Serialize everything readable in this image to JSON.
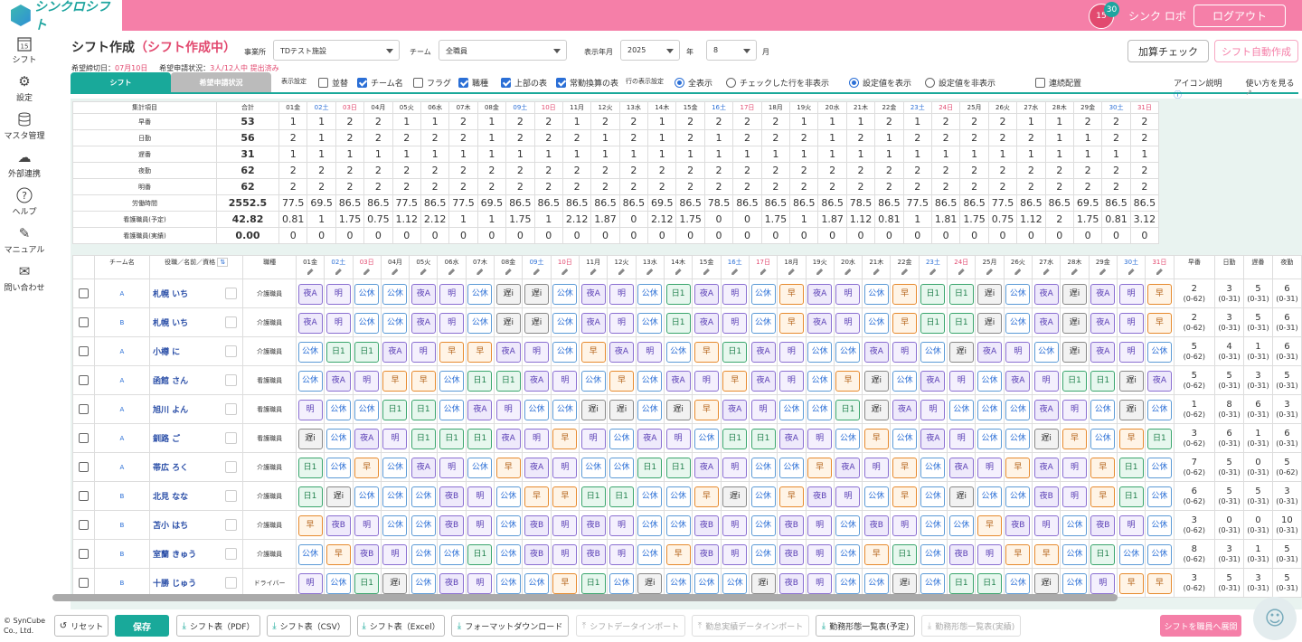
{
  "app": {
    "logo": "シンクロシフト",
    "cal_icon": "15",
    "cal_badge": "30",
    "user": "シンク ロボ",
    "logout": "ログアウト"
  },
  "nav": [
    {
      "label": "シフト",
      "icon": "calendar-icon"
    },
    {
      "label": "設定",
      "icon": "gear-icon"
    },
    {
      "label": "マスタ管理",
      "icon": "database-icon"
    },
    {
      "label": "外部連携",
      "icon": "cloud-icon"
    },
    {
      "label": "ヘルプ",
      "icon": "question-icon"
    },
    {
      "label": "マニュアル",
      "icon": "pencil-icon"
    },
    {
      "label": "問い合わせ",
      "icon": "mail-icon"
    }
  ],
  "page": {
    "title": "シフト作成",
    "mode": "（シフト作成中）",
    "deadline_label": "希望締切日：",
    "deadline": "07月10日",
    "status_label": "希望申請状況：",
    "status": "3人/12人中 提出済み"
  },
  "filters": {
    "facility_label": "事業所",
    "facility": "TDテスト施設",
    "team_label": "チーム",
    "team": "全職員",
    "ym_label": "表示年月",
    "year": "2025",
    "year_unit": "年",
    "month": "8",
    "month_unit": "月"
  },
  "buttons": {
    "calc": "加算チェック",
    "auto": "シフト自動作成"
  },
  "tabs": {
    "shift": "シフト",
    "request": "希望申請状況"
  },
  "options": {
    "display_label": "表示設定",
    "sort": "並替",
    "team_name": "チーム名",
    "flag": "フラグ",
    "job": "職種",
    "upper": "上部の表",
    "fte": "常勤換算の表",
    "row_label": "行の表示設定",
    "show_all": "全表示",
    "hide_checked": "チェックした行を非表示",
    "show_set": "設定値を表示",
    "hide_set": "設定値を非表示",
    "continuous": "連続配置",
    "icon_help": "アイコン説明",
    "howto": "使い方を見る"
  },
  "days": [
    "01金",
    "02土",
    "03日",
    "04月",
    "05火",
    "06水",
    "07木",
    "08金",
    "09土",
    "10日",
    "11月",
    "12火",
    "13水",
    "14木",
    "15金",
    "16土",
    "17日",
    "18月",
    "19火",
    "20水",
    "21木",
    "22金",
    "23土",
    "24日",
    "25月",
    "26火",
    "27水",
    "28木",
    "29金",
    "30土",
    "31日"
  ],
  "summary": {
    "header_item": "集計項目",
    "header_total": "合計",
    "rows": [
      {
        "label": "早番",
        "total": "53",
        "vals": [
          "1",
          "1",
          "2",
          "2",
          "1",
          "1",
          "2",
          "1",
          "2",
          "2",
          "1",
          "2",
          "2",
          "1",
          "2",
          "2",
          "2",
          "2",
          "1",
          "1",
          "1",
          "2",
          "1",
          "2",
          "2",
          "2",
          "1",
          "1",
          "2",
          "2",
          "2"
        ]
      },
      {
        "label": "日勤",
        "total": "56",
        "vals": [
          "2",
          "1",
          "2",
          "2",
          "2",
          "2",
          "2",
          "1",
          "2",
          "2",
          "2",
          "1",
          "2",
          "1",
          "2",
          "1",
          "2",
          "2",
          "2",
          "1",
          "2",
          "1",
          "2",
          "2",
          "2",
          "2",
          "2",
          "1",
          "1",
          "2",
          "2"
        ]
      },
      {
        "label": "遅番",
        "total": "31",
        "vals": [
          "1",
          "1",
          "1",
          "1",
          "1",
          "1",
          "1",
          "1",
          "1",
          "1",
          "1",
          "1",
          "1",
          "1",
          "1",
          "1",
          "1",
          "1",
          "1",
          "1",
          "1",
          "1",
          "1",
          "1",
          "1",
          "1",
          "1",
          "1",
          "1",
          "1",
          "1"
        ]
      },
      {
        "label": "夜勤",
        "total": "62",
        "vals": [
          "2",
          "2",
          "2",
          "2",
          "2",
          "2",
          "2",
          "2",
          "2",
          "2",
          "2",
          "2",
          "2",
          "2",
          "2",
          "2",
          "2",
          "2",
          "2",
          "2",
          "2",
          "2",
          "2",
          "2",
          "2",
          "2",
          "2",
          "2",
          "2",
          "2",
          "2"
        ]
      },
      {
        "label": "明番",
        "total": "62",
        "vals": [
          "2",
          "2",
          "2",
          "2",
          "2",
          "2",
          "2",
          "2",
          "2",
          "2",
          "2",
          "2",
          "2",
          "2",
          "2",
          "2",
          "2",
          "2",
          "2",
          "2",
          "2",
          "2",
          "2",
          "2",
          "2",
          "2",
          "2",
          "2",
          "2",
          "2",
          "2"
        ]
      },
      {
        "label": "労働時間",
        "total": "2552.5",
        "vals": [
          "77.5",
          "69.5",
          "86.5",
          "86.5",
          "77.5",
          "86.5",
          "77.5",
          "69.5",
          "86.5",
          "86.5",
          "86.5",
          "86.5",
          "86.5",
          "69.5",
          "86.5",
          "78.5",
          "86.5",
          "86.5",
          "86.5",
          "86.5",
          "78.5",
          "86.5",
          "77.5",
          "86.5",
          "86.5",
          "77.5",
          "86.5",
          "86.5",
          "69.5",
          "86.5",
          "86.5"
        ]
      },
      {
        "label": "看護職員(予定)",
        "total": "42.82",
        "vals": [
          "0.81",
          "1",
          "1.75",
          "0.75",
          "1.12",
          "2.12",
          "1",
          "1",
          "1.75",
          "1",
          "2.12",
          "1.87",
          "0",
          "2.12",
          "1.75",
          "0",
          "0",
          "1.75",
          "1",
          "1.87",
          "1.12",
          "0.81",
          "1",
          "1.81",
          "1.75",
          "0.75",
          "1.12",
          "2",
          "1.75",
          "0.81",
          "3.12"
        ]
      },
      {
        "label": "看護職員(実績)",
        "total": "0.00",
        "vals": [
          "0",
          "0",
          "0",
          "0",
          "0",
          "0",
          "0",
          "0",
          "0",
          "0",
          "0",
          "0",
          "0",
          "0",
          "0",
          "0",
          "0",
          "0",
          "0",
          "0",
          "0",
          "0",
          "0",
          "0",
          "0",
          "0",
          "0",
          "0",
          "0",
          "0",
          "0"
        ]
      }
    ]
  },
  "staff_header": {
    "team": "チーム名",
    "name": "役職／名前／資格",
    "role": "職種",
    "counts": [
      "早番",
      "日勤",
      "遅番",
      "夜勤"
    ]
  },
  "staff": [
    {
      "team": "A",
      "name": "札幌 いち",
      "role": "介護職員",
      "shifts": [
        "夜A",
        "明",
        "公休",
        "公休",
        "夜A",
        "明",
        "公休",
        "遅i",
        "遅i",
        "公休",
        "夜A",
        "明",
        "公休",
        "日1",
        "夜A",
        "明",
        "公休",
        "早",
        "夜A",
        "明",
        "公休",
        "早",
        "日1",
        "日1",
        "遅i",
        "公休",
        "夜A",
        "遅i",
        "夜A",
        "明",
        "早"
      ],
      "counts": [
        [
          "2",
          "(0-62)"
        ],
        [
          "3",
          "(0-31)"
        ],
        [
          "5",
          "(0-31)"
        ],
        [
          "6",
          "(0-31)"
        ]
      ]
    },
    {
      "team": "B",
      "name": "札幌 いち",
      "role": "介護職員",
      "shifts": [
        "夜A",
        "明",
        "公休",
        "公休",
        "夜A",
        "明",
        "公休",
        "遅i",
        "遅i",
        "公休",
        "夜A",
        "明",
        "公休",
        "日1",
        "夜A",
        "明",
        "公休",
        "早",
        "夜A",
        "明",
        "公休",
        "早",
        "日1",
        "日1",
        "遅i",
        "公休",
        "夜A",
        "遅i",
        "夜A",
        "明",
        "早"
      ],
      "counts": [
        [
          "2",
          "(0-62)"
        ],
        [
          "3",
          "(0-31)"
        ],
        [
          "5",
          "(0-31)"
        ],
        [
          "6",
          "(0-31)"
        ]
      ]
    },
    {
      "team": "A",
      "name": "小樽 に",
      "role": "介護職員",
      "shifts": [
        "公休",
        "日1",
        "日1",
        "夜A",
        "明",
        "早",
        "早",
        "夜A",
        "明",
        "公休",
        "早",
        "夜A",
        "明",
        "公休",
        "早",
        "日1",
        "夜A",
        "明",
        "公休",
        "公休",
        "夜A",
        "明",
        "公休",
        "遅i",
        "夜A",
        "明",
        "公休",
        "遅i",
        "夜A",
        "明",
        "公休"
      ],
      "counts": [
        [
          "5",
          "(0-62)"
        ],
        [
          "4",
          "(0-31)"
        ],
        [
          "1",
          "(0-31)"
        ],
        [
          "6",
          "(0-31)"
        ]
      ]
    },
    {
      "team": "A",
      "name": "函館 さん",
      "role": "看護職員",
      "shifts": [
        "公休",
        "夜A",
        "明",
        "早",
        "早",
        "公休",
        "日1",
        "日1",
        "夜A",
        "明",
        "公休",
        "早",
        "公休",
        "夜A",
        "明",
        "早",
        "夜A",
        "明",
        "公休",
        "早",
        "遅i",
        "公休",
        "夜A",
        "明",
        "公休",
        "夜A",
        "明",
        "日1",
        "日1",
        "遅i",
        "夜A"
      ],
      "counts": [
        [
          "5",
          "(0-62)"
        ],
        [
          "5",
          "(0-31)"
        ],
        [
          "3",
          "(0-31)"
        ],
        [
          "5",
          "(0-31)"
        ]
      ]
    },
    {
      "team": "A",
      "name": "旭川 よん",
      "role": "看護職員",
      "shifts": [
        "明",
        "公休",
        "公休",
        "日1",
        "日1",
        "公休",
        "夜A",
        "明",
        "公休",
        "公休",
        "遅i",
        "遅i",
        "公休",
        "遅i",
        "早",
        "夜A",
        "明",
        "公休",
        "公休",
        "日1",
        "遅i",
        "夜A",
        "明",
        "公休",
        "公休",
        "公休",
        "夜A",
        "明",
        "公休",
        "遅i",
        "公休"
      ],
      "counts": [
        [
          "1",
          "(0-62)"
        ],
        [
          "8",
          "(0-31)"
        ],
        [
          "6",
          "(0-31)"
        ],
        [
          "3",
          "(0-31)"
        ]
      ]
    },
    {
      "team": "A",
      "name": "釧路 ご",
      "role": "看護職員",
      "shifts": [
        "遅i",
        "公休",
        "夜A",
        "明",
        "日1",
        "日1",
        "日1",
        "夜A",
        "明",
        "早",
        "明",
        "公休",
        "夜A",
        "明",
        "公休",
        "日1",
        "日1",
        "夜A",
        "明",
        "公休",
        "早",
        "公休",
        "夜A",
        "明",
        "公休",
        "公休",
        "遅i",
        "早",
        "公休",
        "早",
        "日1"
      ],
      "counts": [
        [
          "3",
          "(0-62)"
        ],
        [
          "6",
          "(0-31)"
        ],
        [
          "1",
          "(0-31)"
        ],
        [
          "6",
          "(0-31)"
        ]
      ]
    },
    {
      "team": "A",
      "name": "帯広 ろく",
      "role": "介護職員",
      "shifts": [
        "日1",
        "公休",
        "早",
        "公休",
        "夜A",
        "明",
        "公休",
        "早",
        "夜A",
        "明",
        "公休",
        "公休",
        "日1",
        "日1",
        "夜A",
        "明",
        "公休",
        "公休",
        "早",
        "夜A",
        "明",
        "早",
        "公休",
        "夜A",
        "明",
        "早",
        "夜A",
        "明",
        "早",
        "日1",
        "公休"
      ],
      "counts": [
        [
          "7",
          "(0-62)"
        ],
        [
          "5",
          "(0-31)"
        ],
        [
          "0",
          "(0-31)"
        ],
        [
          "5",
          "(0-62)"
        ]
      ]
    },
    {
      "team": "B",
      "name": "北見 なな",
      "role": "介護職員",
      "shifts": [
        "日1",
        "遅i",
        "公休",
        "公休",
        "公休",
        "夜B",
        "明",
        "公休",
        "早",
        "早",
        "日1",
        "日1",
        "公休",
        "公休",
        "早",
        "遅i",
        "公休",
        "早",
        "夜B",
        "明",
        "公休",
        "早",
        "公休",
        "遅i",
        "公休",
        "公休",
        "夜B",
        "明",
        "早",
        "日1",
        "公休"
      ],
      "counts": [
        [
          "6",
          "(0-62)"
        ],
        [
          "5",
          "(0-31)"
        ],
        [
          "5",
          "(0-31)"
        ],
        [
          "3",
          "(0-31)"
        ]
      ]
    },
    {
      "team": "B",
      "name": "苫小 はち",
      "role": "介護職員",
      "shifts": [
        "早",
        "夜B",
        "明",
        "公休",
        "公休",
        "夜B",
        "明",
        "公休",
        "夜B",
        "明",
        "夜B",
        "明",
        "公休",
        "公休",
        "夜B",
        "明",
        "公休",
        "夜B",
        "明",
        "公休",
        "夜B",
        "明",
        "公休",
        "公休",
        "早",
        "夜B",
        "明",
        "公休",
        "夜B",
        "明",
        "公休"
      ],
      "counts": [
        [
          "3",
          "(0-62)"
        ],
        [
          "0",
          "(0-31)"
        ],
        [
          "0",
          "(0-31)"
        ],
        [
          "10",
          "(0-31)"
        ]
      ]
    },
    {
      "team": "B",
      "name": "室蘭 きゅう",
      "role": "介護職員",
      "shifts": [
        "公休",
        "早",
        "夜B",
        "明",
        "公休",
        "公休",
        "日1",
        "公休",
        "夜B",
        "明",
        "夜B",
        "明",
        "公休",
        "早",
        "夜B",
        "明",
        "公休",
        "夜B",
        "明",
        "公休",
        "早",
        "日1",
        "公休",
        "夜B",
        "明",
        "早",
        "早",
        "公休",
        "日1",
        "公休",
        "公休"
      ],
      "counts": [
        [
          "8",
          "(0-62)"
        ],
        [
          "3",
          "(0-31)"
        ],
        [
          "1",
          "(0-31)"
        ],
        [
          "5",
          "(0-31)"
        ]
      ]
    },
    {
      "team": "B",
      "name": "十勝 じゅう",
      "role": "ドライバー",
      "shifts": [
        "明",
        "公休",
        "日1",
        "遅i",
        "公休",
        "夜B",
        "明",
        "公休",
        "公休",
        "早",
        "日1",
        "公休",
        "遅i",
        "公休",
        "公休",
        "公休",
        "遅i",
        "夜B",
        "明",
        "公休",
        "公休",
        "遅i",
        "公休",
        "日1",
        "日1",
        "公休",
        "遅i",
        "公休",
        "明",
        "早",
        "早"
      ],
      "counts": [
        [
          "3",
          "(0-62)"
        ],
        [
          "5",
          "(0-31)"
        ],
        [
          "3",
          "(0-31)"
        ],
        [
          "5",
          "(0-31)"
        ]
      ]
    }
  ],
  "footer": {
    "reset": "リセット",
    "save": "保存",
    "pdf": "シフト表（PDF）",
    "csv": "シフト表（CSV）",
    "excel": "シフト表（Excel）",
    "format": "フォーマットダウンロード",
    "import": "シフトデータインポート",
    "attend_import": "勤怠実績データインポート",
    "plan_list": "勤務形態一覧表(予定)",
    "actual_list": "勤務形態一覧表(実績)",
    "deploy": "シフトを職員へ展開",
    "copyright": "© SynCube Co., Ltd."
  }
}
